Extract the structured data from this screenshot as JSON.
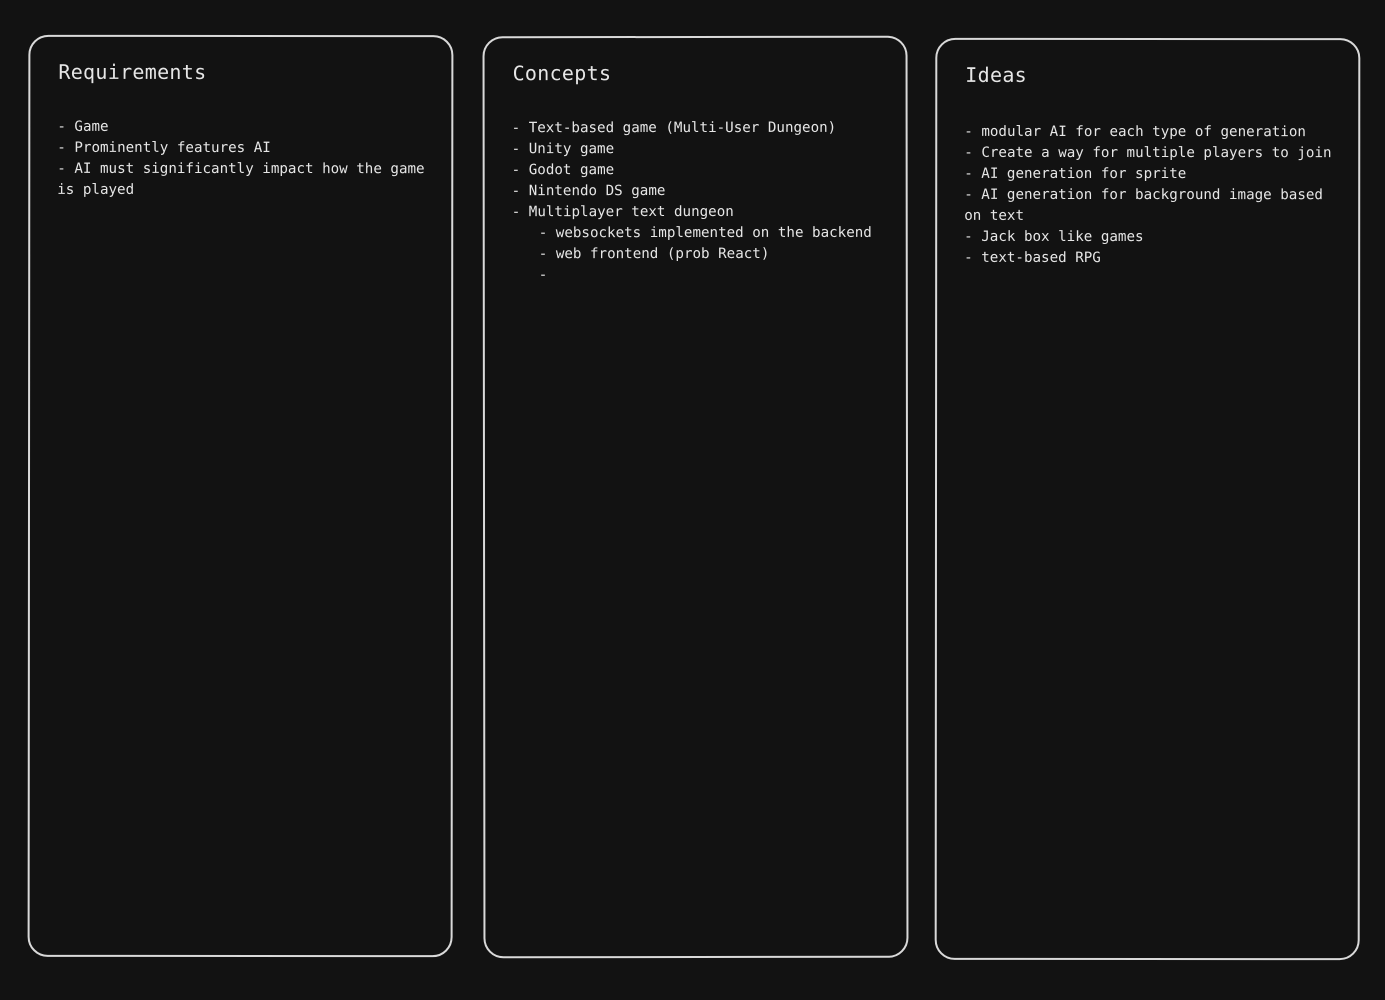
{
  "board": {
    "cards": {
      "requirements": {
        "title": "Requirements",
        "lines": [
          "- Game",
          "- Prominently features AI",
          "- AI must significantly impact how the game is played"
        ]
      },
      "concepts": {
        "title": "Concepts",
        "lines": [
          "- Text-based game (Multi-User Dungeon)",
          "- Unity game",
          "- Godot game",
          "- Nintendo DS game",
          "- Multiplayer text dungeon"
        ],
        "sublines": [
          "- websockets implemented on the backend",
          "- web frontend (prob React)",
          "-"
        ]
      },
      "ideas": {
        "title": "Ideas",
        "lines": [
          "- modular AI for each type of generation",
          "- Create a way for multiple players to join",
          "- AI generation for sprite",
          "- AI generation for background image based on text",
          "- Jack box like games",
          "- text-based RPG"
        ]
      }
    }
  },
  "colors": {
    "background": "#121212",
    "card_stroke": "#d9d9d9",
    "text": "#e6e6e6"
  }
}
